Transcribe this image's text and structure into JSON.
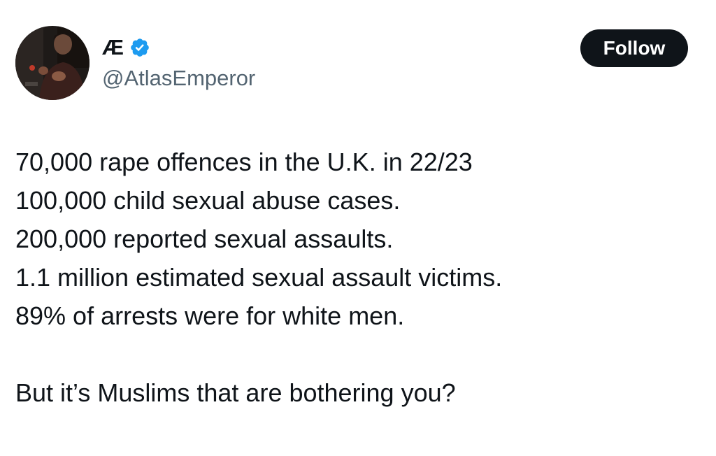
{
  "author": {
    "display_name": "Æ",
    "handle": "@AtlasEmperor",
    "verified": true,
    "avatar_icon": "profile-photo"
  },
  "follow_button": {
    "label": "Follow"
  },
  "tweet": {
    "lines": [
      "70,000 rape offences in the U.K. in 22/23",
      "100,000 child sexual abuse cases.",
      "200,000 reported sexual assaults.",
      "1.1 million estimated sexual assault victims.",
      "89% of arrests were for white men."
    ],
    "closing": "But it’s Muslims that are bothering you?"
  },
  "colors": {
    "text": "#0f1419",
    "secondary_text": "#536471",
    "verified_badge": "#1d9bf0",
    "button_bg": "#0f1419",
    "button_text": "#ffffff"
  }
}
